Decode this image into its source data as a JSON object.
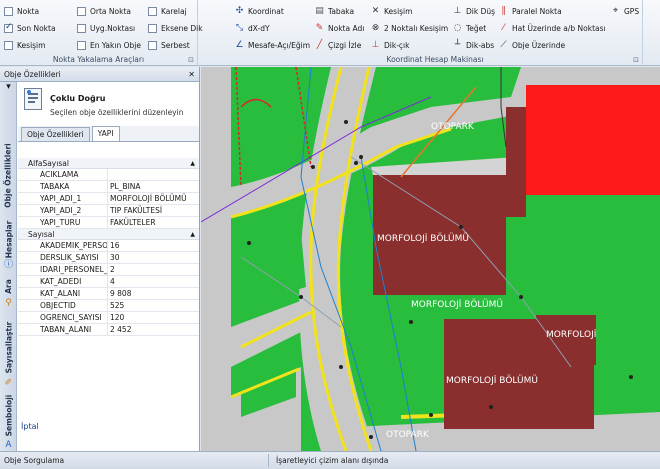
{
  "ribbon": {
    "snap_group": {
      "title": "Nokta Yakalama Araçları",
      "options": [
        {
          "label": "Nokta",
          "checked": false
        },
        {
          "label": "Son Nokta",
          "checked": true
        },
        {
          "label": "Kesişim",
          "checked": false
        },
        {
          "label": "Orta Nokta",
          "checked": false
        },
        {
          "label": "Uyg.Noktası",
          "checked": false
        },
        {
          "label": "En Yakın Obje",
          "checked": false
        },
        {
          "label": "Karelaj",
          "checked": false
        },
        {
          "label": "Eksene Dik",
          "checked": false
        },
        {
          "label": "Serbest",
          "checked": false
        }
      ]
    },
    "coord_group": {
      "title": "Koordinat Hesap Makinası",
      "tools": [
        {
          "label": "Koordinat",
          "icon": "coordinate-icon"
        },
        {
          "label": "dX-dY",
          "icon": "dxdy-icon"
        },
        {
          "label": "Mesafe-Açı/Eğim",
          "icon": "distance-angle-icon"
        },
        {
          "label": "Tabaka",
          "icon": "layer-icon"
        },
        {
          "label": "Nokta Adı",
          "icon": "point-name-icon"
        },
        {
          "label": "Çizgi İzle",
          "icon": "trace-line-icon"
        },
        {
          "label": "Kesişim",
          "icon": "intersection-icon"
        },
        {
          "label": "2 Noktalı Kesişim",
          "icon": "two-point-intersection-icon"
        },
        {
          "label": "Dik-çık",
          "icon": "perpendicular-out-icon"
        },
        {
          "label": "Dik Düş",
          "icon": "perpendicular-drop-icon"
        },
        {
          "label": "Teğet",
          "icon": "tangent-icon"
        },
        {
          "label": "Dik-abs",
          "icon": "perpendicular-abs-icon"
        },
        {
          "label": "Paralel Nokta",
          "icon": "parallel-point-icon"
        },
        {
          "label": "Hat Üzerinde a/b Noktası",
          "icon": "ab-point-on-line-icon"
        },
        {
          "label": "Obje Üzerinde",
          "icon": "on-object-icon"
        },
        {
          "label": "GPS",
          "icon": "gps-icon"
        }
      ]
    }
  },
  "panel": {
    "title": "Obje Özellikleri",
    "header_title": "Çoklu Doğru",
    "header_desc": "Seçilen obje özelliklerini düzenleyin",
    "tabs": [
      "Obje Özellikleri",
      "YAPI"
    ],
    "active_tab": 1,
    "side_tabs": [
      "Obje Özellikleri",
      "Hesaplar",
      "Ara",
      "Sayısallaştır",
      "Semboloji"
    ],
    "categories": [
      {
        "name": "AlfaSayısal",
        "rows": [
          {
            "key": "ACIKLAMA",
            "value": ""
          },
          {
            "key": "TABAKA",
            "value": "PL_BINA"
          },
          {
            "key": "YAPI_ADI_1",
            "value": "MORFOLOJİ BÖLÜMÜ"
          },
          {
            "key": "YAPI_ADI_2",
            "value": "TIP FAKÜLTESİ"
          },
          {
            "key": "YAPI_TURU",
            "value": "FAKÜLTELER"
          }
        ]
      },
      {
        "name": "Sayısal",
        "rows": [
          {
            "key": "AKADEMIK_PERSON",
            "value": "16"
          },
          {
            "key": "DERSLIK_SAYISI",
            "value": "30"
          },
          {
            "key": "IDARI_PERSONEL_S",
            "value": "2"
          },
          {
            "key": "KAT_ADEDI",
            "value": "4"
          },
          {
            "key": "KAT_ALANI",
            "value": "9 808"
          },
          {
            "key": "OBJECTID",
            "value": "525"
          },
          {
            "key": "OGRENCI_SAYISI",
            "value": "120"
          },
          {
            "key": "TABAN_ALANI",
            "value": "2 452"
          }
        ]
      }
    ],
    "cancel_label": "İptal"
  },
  "map": {
    "labels": [
      "OTOPARK",
      "MORFOLOJİ BÖLÜMÜ",
      "MORFOLOJİ BÖLÜMÜ",
      "MORFOLOJİ",
      "MORFOLOJİ BÖLÜMÜ",
      "OTOPARK"
    ],
    "colors": {
      "ground": "#28bd3c",
      "road": "#c8c8c8",
      "building": "#8b2e2e",
      "selected": "#ff1a1a",
      "edge": "#f2e21b"
    }
  },
  "status": {
    "left": "Obje Sorgulama",
    "middle": "İşaretleyici çizim alanı dışında"
  }
}
